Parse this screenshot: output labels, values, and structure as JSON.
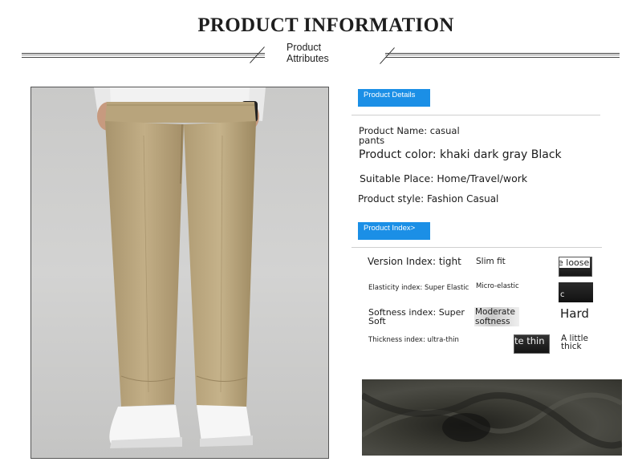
{
  "header": {
    "title": "PRODUCT INFORMATION",
    "subtitle_line1": "Product",
    "subtitle_line2": "Attributes"
  },
  "product_details": {
    "tag": "Product Details",
    "name_line1": "Product Name: casual",
    "name_line2": "pants",
    "color": "Product color: khaki dark gray Black",
    "place": "Suitable Place: Home/Travel/work",
    "style": "Product style: Fashion Casual"
  },
  "product_index": {
    "tag": "Product Index>",
    "rows": [
      {
        "label": "Version Index: tight",
        "mid": "Slim fit",
        "right": "e loose"
      },
      {
        "label": "Elasticity index: Super Elastic",
        "mid": "Micro-elastic",
        "right": "c"
      },
      {
        "label_line1": "Softness index: Super",
        "label_line2": "Soft",
        "mid_line1": "Moderate",
        "mid_line2": "softness",
        "right": "Hard"
      },
      {
        "label": "Thickness index: ultra-thin",
        "mid": "te thin",
        "right_line1": "A little",
        "right_line2": "thick"
      }
    ]
  },
  "images": {
    "product_photo": "khaki-casual-pants-model-photo",
    "fabric_photo": "dark-fabric-closeup-photo"
  },
  "colors": {
    "accent": "#1b8fe6",
    "pants": "#bba680",
    "fabric": "#3a3a33"
  }
}
